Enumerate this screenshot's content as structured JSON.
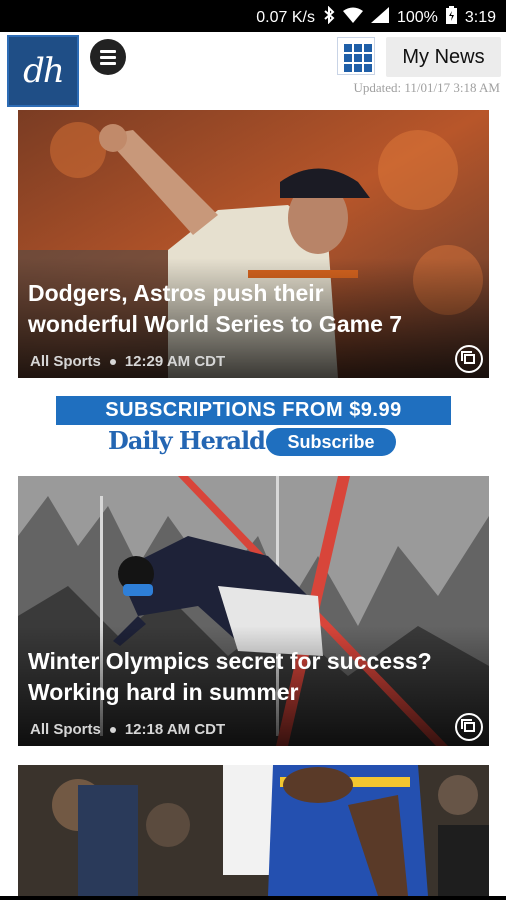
{
  "status_bar": {
    "speed": "0.07 K/s",
    "battery": "100%",
    "time": "3:19",
    "icons": [
      "bluetooth-icon",
      "wifi-icon",
      "signal-icon",
      "battery-icon"
    ]
  },
  "header": {
    "logo_text": "dh",
    "my_news_label": "My News",
    "updated": "Updated: 11/01/17 3:18 AM",
    "icons": [
      "menu-icon",
      "grid-icon"
    ]
  },
  "articles": [
    {
      "headline_line1": "Dodgers, Astros push their",
      "headline_line2": "wonderful World Series to Game 7",
      "category": "All Sports",
      "time": "12:29 AM CDT"
    },
    {
      "headline_line1": "Winter Olympics secret for success?",
      "headline_line2": "Working hard in summer",
      "category": "All Sports",
      "time": "12:18 AM CDT"
    }
  ],
  "ad": {
    "banner": "SUBSCRIPTIONS FROM $9.99",
    "brand": "Daily Herald",
    "button": "Subscribe"
  },
  "colors": {
    "brand_blue": "#1f4e86",
    "ad_blue": "#1f6fbf",
    "status_bg": "#000000"
  }
}
